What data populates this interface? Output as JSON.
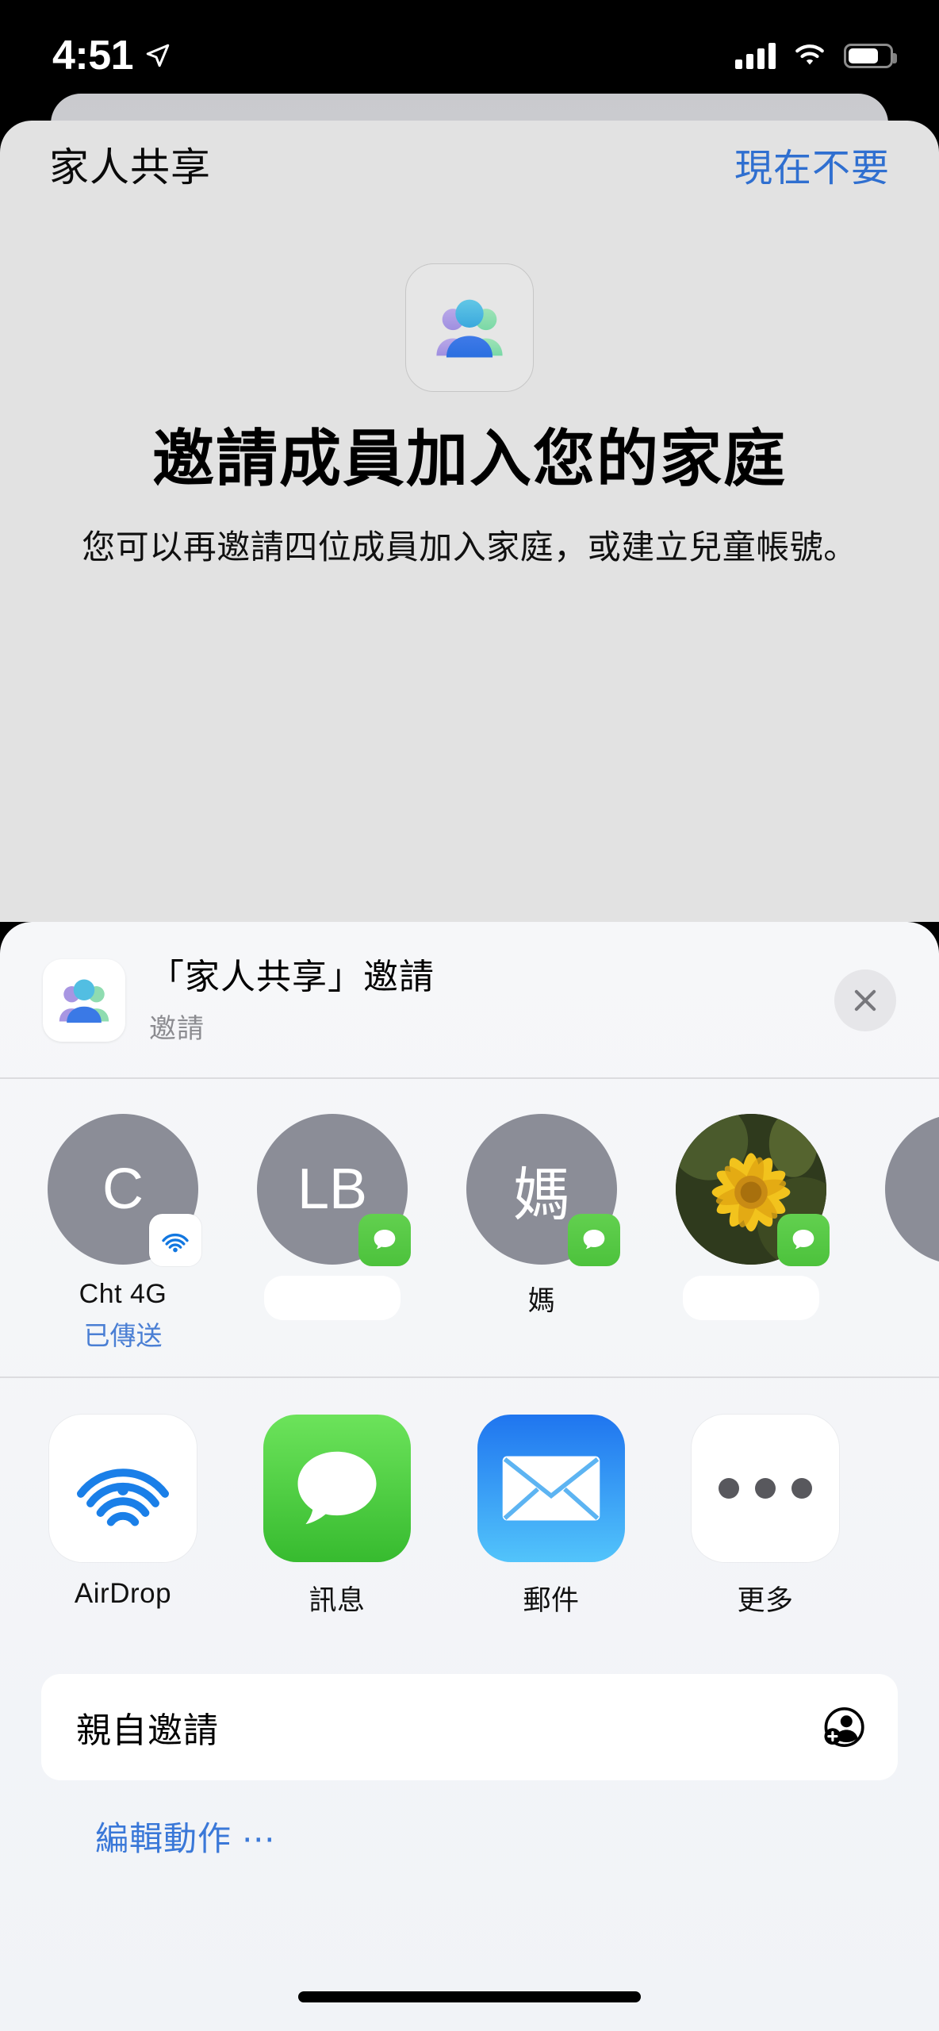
{
  "status_bar": {
    "time": "4:51",
    "location_icon": "location-arrow-icon",
    "signal_icon": "cellular-signal-icon",
    "signal_bars": 4,
    "wifi_icon": "wifi-icon",
    "battery_icon": "battery-icon",
    "battery_level_pct": 70
  },
  "nav": {
    "title": "家人共享",
    "action_label": "現在不要"
  },
  "hero": {
    "icon_name": "family-sharing-icon",
    "title": "邀請成員加入您的家庭",
    "subtitle": "您可以再邀請四位成員加入家庭，或建立兒童帳號。"
  },
  "share_sheet": {
    "icon_name": "family-sharing-icon",
    "title": "「家人共享」邀請",
    "subtitle": "邀請",
    "close_icon": "close-icon",
    "contacts": [
      {
        "initials": "C",
        "name": "Cht 4G",
        "status": "已傳送",
        "badge": "airdrop-icon",
        "avatar_type": "initials",
        "redacted": false
      },
      {
        "initials": "LB",
        "name": "",
        "status": "",
        "badge": "messages-icon",
        "avatar_type": "initials",
        "redacted": true
      },
      {
        "initials": "媽",
        "name": "媽",
        "status": "",
        "badge": "messages-icon",
        "avatar_type": "initials",
        "redacted": false
      },
      {
        "initials": "",
        "name": "",
        "status": "",
        "badge": "messages-icon",
        "avatar_type": "photo",
        "redacted": true
      },
      {
        "initials": "",
        "name": "",
        "status": "",
        "badge": "",
        "avatar_type": "initials",
        "redacted": false
      }
    ],
    "apps": [
      {
        "label": "AirDrop",
        "icon_name": "airdrop-icon"
      },
      {
        "label": "訊息",
        "icon_name": "messages-icon"
      },
      {
        "label": "郵件",
        "icon_name": "mail-icon"
      },
      {
        "label": "更多",
        "icon_name": "more-ellipsis-icon"
      }
    ],
    "actions": [
      {
        "label": "親自邀請",
        "icon_name": "person-add-icon"
      }
    ],
    "edit_actions_label": "編輯動作 ⋯"
  },
  "colors": {
    "accent_blue": "#2f6fd0",
    "link_blue": "#3a78d8",
    "sent_blue": "#4a7fd4",
    "avatar_gray": "#8b8d97",
    "messages_green": "#4cc23c",
    "sheet_bg": "#f4f5f8",
    "page_bg": "#e2e2e2"
  },
  "home_indicator": "home-indicator"
}
